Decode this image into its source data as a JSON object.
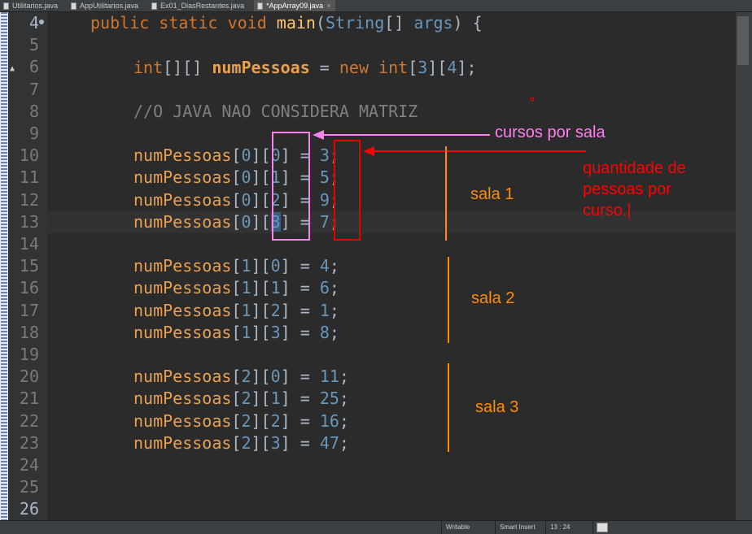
{
  "tabs": [
    {
      "label": "Utilitarios.java",
      "active": false
    },
    {
      "label": "AppUtilitarios.java",
      "active": false
    },
    {
      "label": "Ex01_DiasRestantes.java",
      "active": false
    },
    {
      "label": "*AppArray09.java",
      "active": true
    }
  ],
  "line_numbers": [
    "4",
    "5",
    "6",
    "7",
    "8",
    "9",
    "10",
    "11",
    "12",
    "13",
    "14",
    "15",
    "16",
    "17",
    "18",
    "19",
    "20",
    "21",
    "22",
    "23",
    "24",
    "25",
    "26"
  ],
  "code": {
    "l4": {
      "kw1": "public static void ",
      "fn": "main",
      "p1": "(",
      "cls": "String",
      "p2": "[] ",
      "args": "args",
      "p3": ") {"
    },
    "l6": {
      "kw1": "int",
      "p1": "[][] ",
      "var": "numPessoas",
      "p2": " = ",
      "kw2": "new int",
      "p3": "[",
      "n1": "3",
      "p4": "][",
      "n2": "4",
      "p5": "];"
    },
    "l8": {
      "comment": "//O JAVA NAO CONSIDERA MATRIZ"
    },
    "assignments": [
      {
        "i": "0",
        "j": "0",
        "v": "3"
      },
      {
        "i": "0",
        "j": "1",
        "v": "5"
      },
      {
        "i": "0",
        "j": "2",
        "v": "9"
      },
      {
        "i": "0",
        "j": "3",
        "v": "7"
      },
      {
        "i": "1",
        "j": "0",
        "v": "4"
      },
      {
        "i": "1",
        "j": "1",
        "v": "6"
      },
      {
        "i": "1",
        "j": "2",
        "v": "1"
      },
      {
        "i": "1",
        "j": "3",
        "v": "8"
      },
      {
        "i": "2",
        "j": "0",
        "v": "11"
      },
      {
        "i": "2",
        "j": "1",
        "v": "25"
      },
      {
        "i": "2",
        "j": "2",
        "v": "16"
      },
      {
        "i": "2",
        "j": "3",
        "v": "47"
      }
    ],
    "var_name": "numPessoas"
  },
  "annotations": {
    "cursos": "cursos por sala",
    "quantidade": "quantidade de\npessoas por\ncurso.|",
    "sala1": "sala 1",
    "sala2": "sala 2",
    "sala3": "sala 3"
  },
  "status": {
    "writable": "Writable",
    "insert_mode": "Smart Insert",
    "position": "13 : 24"
  },
  "colors": {
    "pink": "#ff7ff0",
    "red": "#ff0000",
    "orange": "#ff8c00"
  },
  "icons": [
    "file-icon",
    "close-icon",
    "breakpoint-icon",
    "status-icon"
  ]
}
